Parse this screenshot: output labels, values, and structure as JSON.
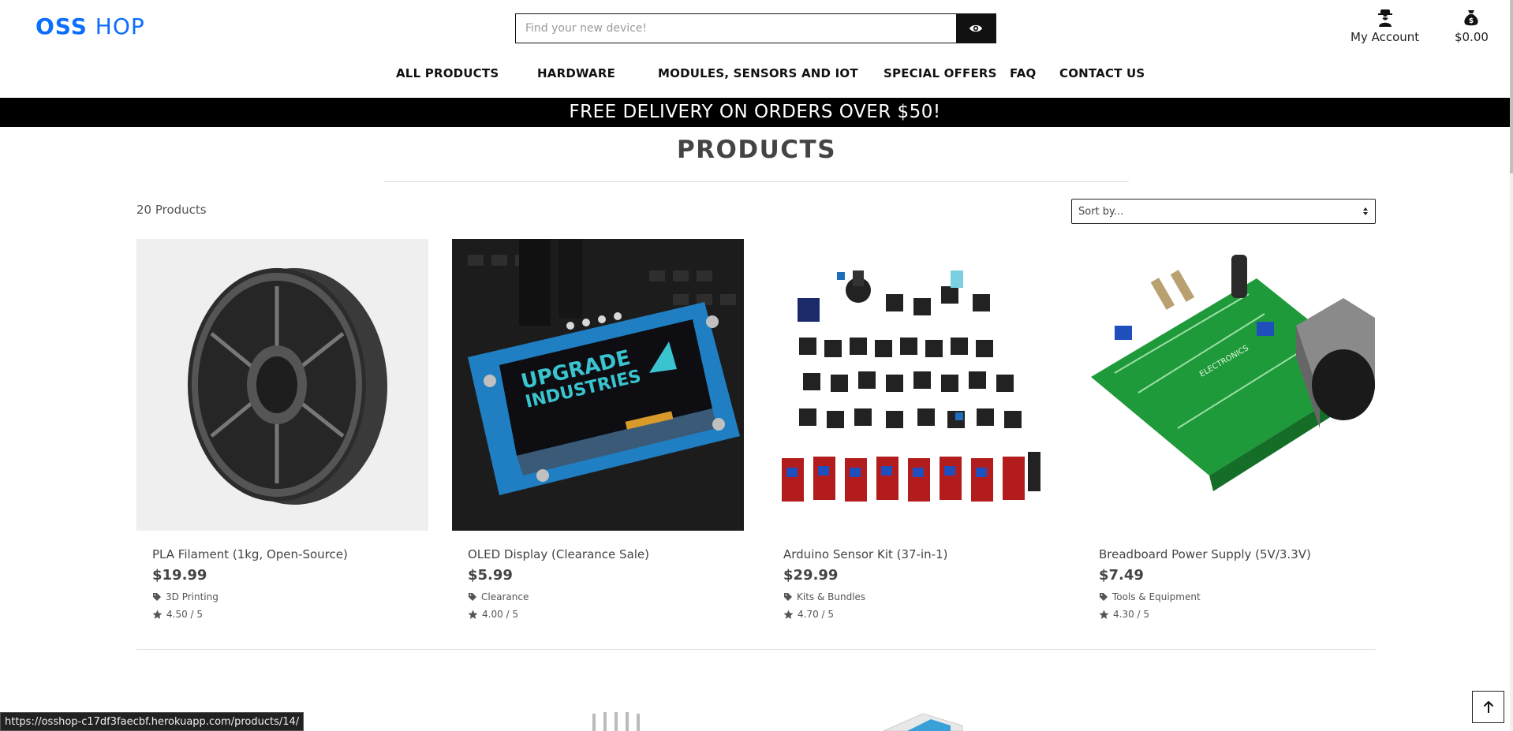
{
  "header": {
    "logo_bold": "OSS",
    "logo_light": "HOP",
    "search_placeholder": "Find your new device!",
    "account_label": "My Account",
    "cart_total": "$0.00"
  },
  "nav": {
    "items": [
      "ALL PRODUCTS",
      "HARDWARE",
      "MODULES, SENSORS AND IOT",
      "SPECIAL OFFERS",
      "FAQ",
      "CONTACT US"
    ]
  },
  "banner": "FREE DELIVERY ON ORDERS OVER $50!",
  "products_page": {
    "title": "PRODUCTS",
    "count": "20 Products",
    "sort_label": "Sort by..."
  },
  "products": [
    {
      "name": "PLA Filament (1kg, Open-Source)",
      "price": "$19.99",
      "category": "3D Printing",
      "rating": "4.50 / 5",
      "image": "filament-spool"
    },
    {
      "name": "OLED Display (Clearance Sale)",
      "price": "$5.99",
      "category": "Clearance",
      "rating": "4.00 / 5",
      "image": "oled-display"
    },
    {
      "name": "Arduino Sensor Kit (37-in-1)",
      "price": "$29.99",
      "category": "Kits & Bundles",
      "rating": "4.70 / 5",
      "image": "sensor-kit"
    },
    {
      "name": "Breadboard Power Supply (5V/3.3V)",
      "price": "$7.49",
      "category": "Tools & Equipment",
      "rating": "4.30 / 5",
      "image": "power-supply"
    }
  ],
  "status_url": "https://osshop-c17df3faecbf.herokuapp.com/products/14/",
  "colors": {
    "brand": "#0d6efd",
    "banner_bg": "#000000",
    "text": "#444444"
  }
}
